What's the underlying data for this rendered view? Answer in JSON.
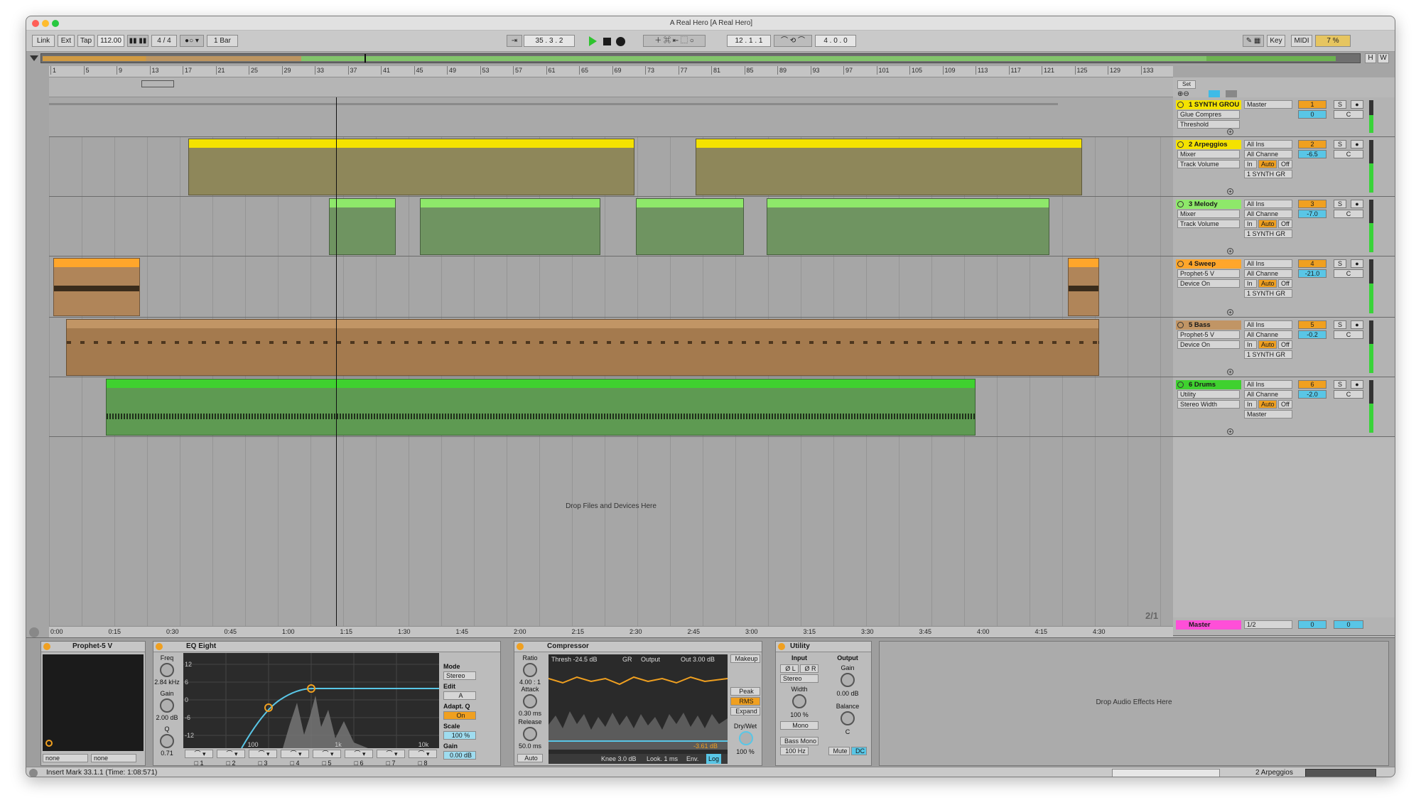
{
  "window": {
    "title": "A Real Hero  [A Real Hero]"
  },
  "toolbar": {
    "link": "Link",
    "ext": "Ext",
    "tap": "Tap",
    "tempo": "112.00",
    "signature": "4 / 4",
    "quantize": "1 Bar",
    "position": "35 .  3 .  2",
    "loop_start": "12 .  1 .  1",
    "loop_length": "4 .  0 .  0",
    "key": "Key",
    "midi": "MIDI",
    "cpu": "7 %"
  },
  "overview": {
    "h": "H",
    "w": "W"
  },
  "ruler": {
    "bars": [
      "1",
      "5",
      "9",
      "13",
      "17",
      "21",
      "25",
      "29",
      "33",
      "37",
      "41",
      "45",
      "49",
      "53",
      "57",
      "61",
      "65",
      "69",
      "73",
      "77",
      "81",
      "85",
      "89",
      "93",
      "97",
      "101",
      "105",
      "109",
      "113",
      "117",
      "121",
      "125",
      "129",
      "133"
    ]
  },
  "timebar": {
    "times": [
      "0:00",
      "0:15",
      "0:30",
      "0:45",
      "1:00",
      "1:15",
      "1:30",
      "1:45",
      "2:00",
      "2:15",
      "2:30",
      "2:45",
      "3:00",
      "3:15",
      "3:30",
      "3:45",
      "4:00",
      "4:15",
      "4:30"
    ]
  },
  "arrangement": {
    "drop_text": "Drop Files and Devices Here",
    "page_label": "2/1",
    "set_label": "Set"
  },
  "tracks": [
    {
      "name": "1 SYNTH GROU",
      "device": "Glue Compres",
      "param": "Threshold",
      "input": "Master",
      "number": "1",
      "volume": "0",
      "pan": "C",
      "color": "#f4e200"
    },
    {
      "name": "2 Arpeggios",
      "device": "Mixer",
      "param": "Track Volume",
      "input": "All Ins",
      "channel": "All Channe",
      "output": "1 SYNTH GR",
      "number": "2",
      "volume": "-6.5",
      "pan": "C",
      "color": "#f4e200"
    },
    {
      "name": "3 Melody",
      "device": "Mixer",
      "param": "Track Volume",
      "input": "All Ins",
      "channel": "All Channe",
      "output": "1 SYNTH GR",
      "number": "3",
      "volume": "-7.0",
      "pan": "C",
      "color": "#8ee86a"
    },
    {
      "name": "4 Sweep",
      "device": "Prophet-5 V",
      "param": "Device On",
      "input": "All Ins",
      "channel": "All Channe",
      "output": "1 SYNTH GR",
      "number": "4",
      "volume": "-21.0",
      "pan": "C",
      "color": "#ffa62b"
    },
    {
      "name": "5 Bass",
      "device": "Prophet-5 V",
      "param": "Device On",
      "input": "All Ins",
      "channel": "All Channe",
      "output": "1 SYNTH GR",
      "number": "5",
      "volume": "-0.2",
      "pan": "C",
      "color": "#c19565"
    },
    {
      "name": "6 Drums",
      "device": "Utility",
      "param": "Stereo Width",
      "input": "All Ins",
      "channel": "All Channe",
      "output": "Master",
      "number": "6",
      "volume": "-2.0",
      "pan": "C",
      "color": "#3fd12f"
    }
  ],
  "track_buttons": {
    "solo": "S",
    "in": "In",
    "auto": "Auto",
    "off": "Off"
  },
  "master": {
    "name": "Master",
    "route": "1/2",
    "volume": "0",
    "pan": "0"
  },
  "devices": {
    "prophet": {
      "title": "Prophet-5 V",
      "slot_a": "none",
      "slot_b": "none"
    },
    "eq": {
      "title": "EQ Eight",
      "freq_label": "Freq",
      "freq": "2.84 kHz",
      "gain_label": "Gain",
      "gain": "2.00 dB",
      "q_label": "Q",
      "q": "0.71",
      "mode_label": "Mode",
      "mode": "Stereo",
      "edit_label": "Edit",
      "edit": "A",
      "adapt_label": "Adapt. Q",
      "adapt": "On",
      "scale_label": "Scale",
      "scale": "100 %",
      "outgain_label": "Gain",
      "outgain": "0.00 dB",
      "ylabels": [
        "12",
        "6",
        "0",
        "-6",
        "-12"
      ],
      "xlabels": [
        "100",
        "1k",
        "10k"
      ],
      "bands": [
        "1",
        "2",
        "3",
        "4",
        "5",
        "6",
        "7",
        "8"
      ]
    },
    "comp": {
      "title": "Compressor",
      "ratio_label": "Ratio",
      "ratio": "4.00 : 1",
      "attack_label": "Attack",
      "attack": "0.30 ms",
      "release_label": "Release",
      "release": "50.0 ms",
      "auto": "Auto",
      "thresh": "Thresh -24.5 dB",
      "gr": "GR",
      "output": "Output",
      "out": "Out 3.00 dB",
      "makeup": "Makeup",
      "peak": "Peak",
      "rms": "RMS",
      "expand": "Expand",
      "drywet_label": "Dry/Wet",
      "drywet": "100 %",
      "reading": "-3.61 dB",
      "knee": "Knee 3.0 dB",
      "look": "Look. 1 ms",
      "env": "Env.",
      "log": "Log"
    },
    "utility": {
      "title": "Utility",
      "input_label": "Input",
      "output_label": "Output",
      "phase_l": "Ø L",
      "phase_r": "Ø R",
      "stereo": "Stereo",
      "width_label": "Width",
      "width": "100 %",
      "mono": "Mono",
      "bass_mono": "Bass Mono",
      "bass_freq": "100 Hz",
      "gain_label": "Gain",
      "gain": "0.00 dB",
      "balance_label": "Balance",
      "balance": "C",
      "mute": "Mute",
      "dc": "DC"
    },
    "drop_fx": "Drop Audio Effects Here"
  },
  "status": {
    "message": "Insert Mark 33.1.1 (Time: 1:08:571)",
    "track": "2 Arpeggios"
  }
}
